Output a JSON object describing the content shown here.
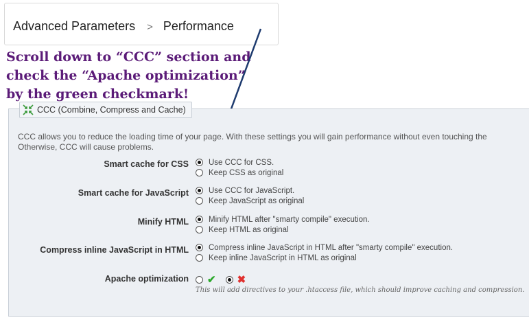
{
  "breadcrumb": {
    "parent": "Advanced Parameters",
    "separator": ">",
    "current": "Performance"
  },
  "annotation": {
    "line1": "Scroll down to “CCC” section and",
    "line2": "check the “Apache optimization”",
    "line3": "by the green checkmark!"
  },
  "section": {
    "title": "CCC (Combine, Compress and Cache)",
    "description_line1": "CCC allows you to reduce the loading time of your page. With these settings you will gain performance without even touching the",
    "description_line2": "Otherwise, CCC will cause problems."
  },
  "settings": {
    "css": {
      "label": "Smart cache for CSS",
      "option1": "Use CCC for CSS.",
      "option2": "Keep CSS as original",
      "selected": 1
    },
    "js": {
      "label": "Smart cache for JavaScript",
      "option1": "Use CCC for JavaScript.",
      "option2": "Keep JavaScript as original",
      "selected": 1
    },
    "html": {
      "label": "Minify HTML",
      "option1": "Minify HTML after \"smarty compile\" execution.",
      "option2": "Keep HTML as original",
      "selected": 1
    },
    "inline_js": {
      "label": "Compress inline JavaScript in HTML",
      "option1": "Compress inline JavaScript in HTML after \"smarty compile\" execution.",
      "option2": "Keep inline JavaScript in HTML as original",
      "selected": 1
    },
    "apache": {
      "label": "Apache optimization",
      "hint": "This will add directives to your .htaccess file, which should improve caching and compression.",
      "selected": "no"
    }
  },
  "colors": {
    "annotation": "#5b1b78",
    "arrow": "#1d3a6e",
    "check": "#2aa82a",
    "cross": "#e0312f",
    "panel": "#edf0f4"
  },
  "icons": {
    "legend": "compress-arrows-icon",
    "yes": "checkmark-icon",
    "no": "cross-icon"
  }
}
